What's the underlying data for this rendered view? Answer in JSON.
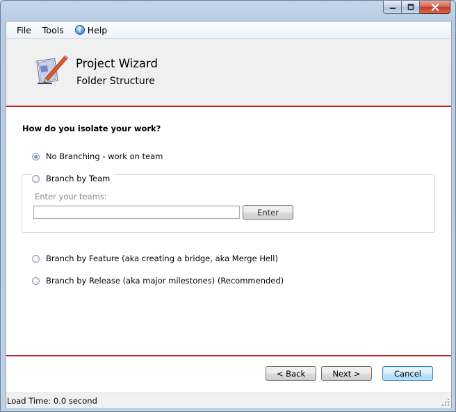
{
  "menu": {
    "file": "File",
    "tools": "Tools",
    "help": "Help"
  },
  "header": {
    "title": "Project Wizard",
    "subtitle": "Folder Structure"
  },
  "form": {
    "question": "How do you isolate your work?",
    "options": [
      {
        "label": "No Branching - work on team",
        "selected": true
      },
      {
        "label": "Branch by Team",
        "selected": false
      },
      {
        "label": "Branch by Feature (aka creating a bridge, aka Merge Hell)",
        "selected": false
      },
      {
        "label": "Branch by Release (aka major milestones) (Recommended)",
        "selected": false
      }
    ],
    "teams_label": "Enter your teams:",
    "teams_value": "",
    "enter_button": "Enter"
  },
  "buttons": {
    "back": "< Back",
    "next": "Next >",
    "cancel": "Cancel"
  },
  "status": {
    "text": "Load Time: 0.0 second"
  },
  "colors": {
    "accent_line": "#c82424",
    "default_button_border": "#3c7fb1"
  },
  "icons": {
    "header": "pencil-paper-icon",
    "help": "help-icon"
  }
}
